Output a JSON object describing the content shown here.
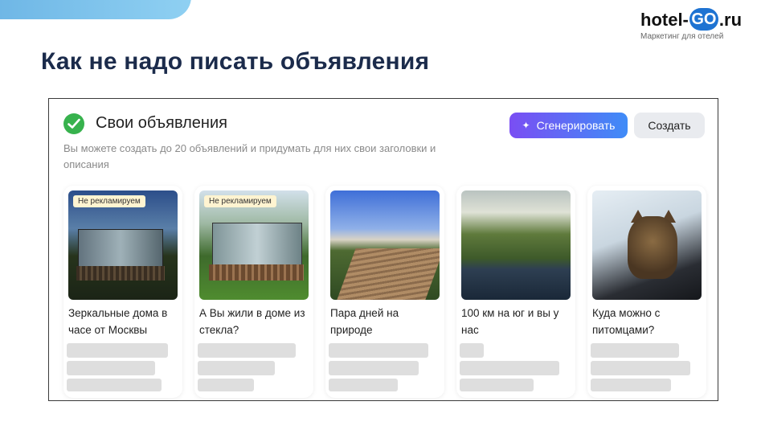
{
  "logo": {
    "prefix": "hotel-",
    "badge": "GO",
    "suffix": ".ru",
    "tagline": "Маркетинг для отелей"
  },
  "page_title": "Как не надо писать объявления",
  "panel": {
    "title": "Свои объявления",
    "description": "Вы можете создать до 20 объявлений и придумать для них свои заголовки и описания",
    "generate_button": "Сгенерировать",
    "create_button": "Создать",
    "accent_colors": {
      "generate_start": "#7a4ef3",
      "generate_end": "#3f8cf7",
      "check": "#37b24d"
    }
  },
  "cards": [
    {
      "badge": "Не рекламируем",
      "title": "Зеркальные дома в часе от Москвы"
    },
    {
      "badge": "Не рекламируем",
      "title": "А Вы жили в доме из стекла?"
    },
    {
      "badge": "",
      "title": "Пара дней на природе"
    },
    {
      "badge": "",
      "title": "100 км на юг и вы у нас"
    },
    {
      "badge": "",
      "title": "Куда можно с питомцами?"
    }
  ]
}
